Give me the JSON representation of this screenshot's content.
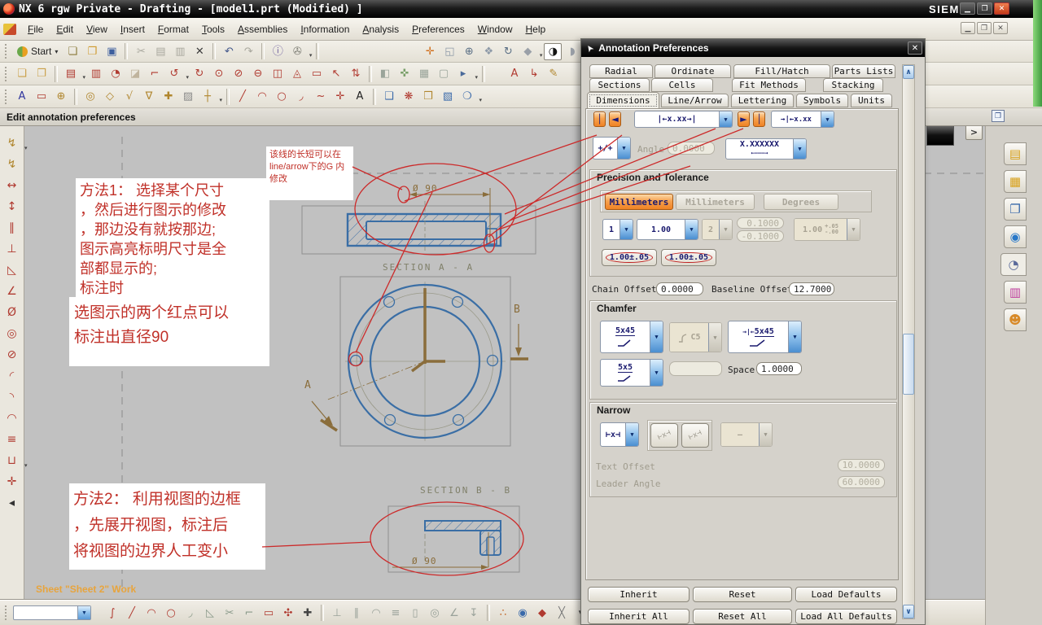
{
  "window": {
    "title": "NX 6 rgw Private - Drafting - [model1.prt (Modified) ]",
    "brand": "SIEMENS"
  },
  "menu": {
    "items": [
      "File",
      "Edit",
      "View",
      "Insert",
      "Format",
      "Tools",
      "Assemblies",
      "Information",
      "Analysis",
      "Preferences",
      "Window",
      "Help"
    ]
  },
  "prompt": "Edit annotation preferences",
  "toolbars": {
    "start_label": "Start",
    "row1": [
      {
        "n": "new-file",
        "g": "❏",
        "c": "#8a7a3a"
      },
      {
        "n": "open-file",
        "g": "❐",
        "c": "#cf9a2e"
      },
      {
        "n": "save",
        "g": "▣",
        "c": "#3d5f9e"
      },
      {
        "n": "sep"
      },
      {
        "n": "cut",
        "g": "✂",
        "c": "#a9a89e"
      },
      {
        "n": "copy",
        "g": "▤",
        "c": "#a9a89e"
      },
      {
        "n": "paste",
        "g": "▥",
        "c": "#a9a89e"
      },
      {
        "n": "delete",
        "g": "✕",
        "c": "#3b3b3b"
      },
      {
        "n": "sep"
      },
      {
        "n": "undo",
        "g": "↶",
        "c": "#44598c"
      },
      {
        "n": "redo",
        "g": "↷",
        "c": "#a9a89e"
      },
      {
        "n": "sep"
      },
      {
        "n": "information",
        "g": "ⓘ",
        "c": "#6a5a9c"
      },
      {
        "n": "command-finder",
        "g": "✇",
        "c": "#7d7d74",
        "k": "dd"
      }
    ],
    "row1_right": [
      {
        "n": "fit-view",
        "g": "✛",
        "c": "#d0701e"
      },
      {
        "n": "zoom-window",
        "g": "◱",
        "c": "#8e9aa8"
      },
      {
        "n": "zoom-in-out",
        "g": "⊕",
        "c": "#5a6f85"
      },
      {
        "n": "pan-view",
        "g": "❖",
        "c": "#8e9aa8"
      },
      {
        "n": "rotate-view",
        "g": "↻",
        "c": "#5a6f85"
      },
      {
        "n": "shaded-display",
        "g": "◆",
        "c": "#9aa0a8",
        "k": "dd"
      },
      {
        "n": "rendering-style",
        "g": "◑",
        "c": "#141414",
        "k": "box"
      },
      {
        "n": "display-options",
        "g": "◗",
        "c": "#9aa0a8",
        "k": "dd"
      },
      {
        "n": "window-display",
        "g": "■",
        "c": "#a8a8a0",
        "k": "dd"
      }
    ],
    "row2": [
      {
        "n": "new-sheet",
        "g": "❏",
        "c": "#caa04a"
      },
      {
        "n": "open-sheet",
        "g": "❐",
        "c": "#caa04a"
      },
      {
        "n": "sep"
      },
      {
        "n": "base-view",
        "g": "▤",
        "c": "#b03a30",
        "k": "dd"
      },
      {
        "n": "projected-view",
        "g": "▥",
        "c": "#b03a30"
      },
      {
        "n": "detail-view",
        "g": "◔",
        "c": "#b03a30"
      },
      {
        "n": "eraser",
        "g": "◪",
        "c": "#c0b49e"
      },
      {
        "n": "view-break",
        "g": "⌐",
        "c": "#b03a30"
      },
      {
        "n": "update-views",
        "g": "↺",
        "c": "#b03a30",
        "k": "dd"
      },
      {
        "n": "rotate-view-tool",
        "g": "↻",
        "c": "#b03a30"
      },
      {
        "n": "revolved-section-view",
        "g": "⊙",
        "c": "#b03a30"
      },
      {
        "n": "section-view",
        "g": "⊘",
        "c": "#b03a30"
      },
      {
        "n": "half-section-view",
        "g": "⊖",
        "c": "#b03a30"
      },
      {
        "n": "break-out-section",
        "g": "◫",
        "c": "#b03a30"
      },
      {
        "n": "unfolded-section-view",
        "g": "◬",
        "c": "#b03a30"
      },
      {
        "n": "view-boundary",
        "g": "▭",
        "c": "#b03a30"
      },
      {
        "n": "move-copy-view",
        "g": "↖",
        "c": "#b03a30"
      },
      {
        "n": "align-views",
        "g": "⇅",
        "c": "#b03a30"
      },
      {
        "n": "sep"
      },
      {
        "n": "sheet-layout",
        "g": "◧",
        "c": "#9aa49a"
      },
      {
        "n": "view-origin",
        "g": "✜",
        "c": "#7aa06a"
      },
      {
        "n": "drawing-format",
        "g": "▦",
        "c": "#9aa49a"
      },
      {
        "n": "display-sheet",
        "g": "▢",
        "c": "#9aa49a"
      },
      {
        "n": "selection-mode",
        "g": "▸",
        "c": "#4a6a9a",
        "k": "dd"
      }
    ],
    "row2_right": [
      {
        "n": "annotation-style",
        "g": "A",
        "c": "#b03a30"
      },
      {
        "n": "leader",
        "g": "↳",
        "c": "#b03a30"
      },
      {
        "n": "edit-object",
        "g": "✎",
        "c": "#b0862e"
      }
    ],
    "row3": [
      {
        "n": "note",
        "g": "A",
        "c": "#30369e"
      },
      {
        "n": "feature-control-frame",
        "g": "▭",
        "c": "#b03a30"
      },
      {
        "n": "datum-feature-symbol",
        "g": "⊕",
        "c": "#b0862e"
      },
      {
        "n": "sep"
      },
      {
        "n": "balloon",
        "g": "◎",
        "c": "#b0862e"
      },
      {
        "n": "id-symbol",
        "g": "◇",
        "c": "#b0862e"
      },
      {
        "n": "surface-finish-symbol",
        "g": "√",
        "c": "#b0862e"
      },
      {
        "n": "weld-symbol",
        "g": "∇",
        "c": "#b0862e"
      },
      {
        "n": "target-point-symbol",
        "g": "✚",
        "c": "#b0862e"
      },
      {
        "n": "crosshatch",
        "g": "▨",
        "c": "#8a8a8a"
      },
      {
        "n": "centerline",
        "g": "┼",
        "c": "#b0862e",
        "k": "dd"
      },
      {
        "n": "sep"
      },
      {
        "n": "line",
        "g": "╱",
        "c": "#b03a30"
      },
      {
        "n": "arc",
        "g": "◠",
        "c": "#b03a30"
      },
      {
        "n": "circle",
        "g": "○",
        "c": "#b03a30"
      },
      {
        "n": "fillet",
        "g": "◞",
        "c": "#b03a30"
      },
      {
        "n": "spline",
        "g": "~",
        "c": "#b03a30"
      },
      {
        "n": "point",
        "g": "✛",
        "c": "#b03a30"
      },
      {
        "n": "text",
        "g": "A",
        "c": "#222"
      },
      {
        "n": "sep"
      },
      {
        "n": "bounded-plane",
        "g": "❑",
        "c": "#3a6aaa"
      },
      {
        "n": "curve-edit",
        "g": "❋",
        "c": "#b03a30"
      },
      {
        "n": "pattern",
        "g": "❒",
        "c": "#b0862e"
      },
      {
        "n": "raster-image",
        "g": "▧",
        "c": "#3a6aaa"
      },
      {
        "n": "display-views",
        "g": "❍",
        "c": "#3a6aaa",
        "k": "dd"
      }
    ],
    "left": [
      {
        "n": "inferred-dimension",
        "g": "↯",
        "c": "#b0862e",
        "k": "dd"
      },
      {
        "n": "auto-dimension",
        "g": "↯",
        "c": "#b0862e"
      },
      {
        "n": "horizontal-dimension",
        "g": "↔",
        "c": "#b03a30"
      },
      {
        "n": "vertical-dimension",
        "g": "↕",
        "c": "#b03a30"
      },
      {
        "n": "parallel-dimension",
        "g": "∥",
        "c": "#b03a30"
      },
      {
        "n": "perpendicular-dimension",
        "g": "⊥",
        "c": "#b03a30"
      },
      {
        "n": "chamfer-dimension",
        "g": "◺",
        "c": "#b03a30"
      },
      {
        "n": "angular-dimension",
        "g": "∠",
        "c": "#b03a30"
      },
      {
        "n": "cylindrical-dimension",
        "g": "Ø",
        "c": "#b03a30"
      },
      {
        "n": "hole-dimension",
        "g": "◎",
        "c": "#b03a30"
      },
      {
        "n": "diameter-dimension",
        "g": "⊘",
        "c": "#b03a30"
      },
      {
        "n": "radius-dimension",
        "g": "◜",
        "c": "#b03a30"
      },
      {
        "n": "radius-to-center-dimension",
        "g": "◝",
        "c": "#b03a30"
      },
      {
        "n": "folded-radius-dimension",
        "g": "◠",
        "c": "#b03a30"
      },
      {
        "n": "thickness-dimension",
        "g": "≡",
        "c": "#b03a30"
      },
      {
        "n": "ordinate-dimension",
        "g": "⊔",
        "c": "#b03a30",
        "k": "dd"
      },
      {
        "n": "crosshair",
        "g": "✛",
        "c": "#b03a30"
      },
      {
        "n": "collapse",
        "g": "◂",
        "c": "#333"
      }
    ],
    "bottom": [
      {
        "n": "profile",
        "g": "∫",
        "c": "#b03a30"
      },
      {
        "n": "sketch-line",
        "g": "╱",
        "c": "#b03a30"
      },
      {
        "n": "sketch-arc",
        "g": "◠",
        "c": "#b03a30"
      },
      {
        "n": "sketch-circle",
        "g": "○",
        "c": "#b03a30"
      },
      {
        "n": "sketch-fillet",
        "g": "◞",
        "c": "#8a9a8a"
      },
      {
        "n": "sketch-chamfer",
        "g": "◺",
        "c": "#8a9a8a"
      },
      {
        "n": "quick-trim",
        "g": "✂",
        "c": "#8a9a8a"
      },
      {
        "n": "quick-extend",
        "g": "⌐",
        "c": "#8a9a8a"
      },
      {
        "n": "rectangle",
        "g": "▭",
        "c": "#b03a30"
      },
      {
        "n": "pattern-curve",
        "g": "✣",
        "c": "#b03a30"
      },
      {
        "n": "sketch-point",
        "g": "✚",
        "c": "#444"
      },
      {
        "n": "sep"
      },
      {
        "n": "constraint-perpendicular",
        "g": "⊥",
        "c": "#9aa29a"
      },
      {
        "n": "constraint-parallel",
        "g": "∥",
        "c": "#9aa29a"
      },
      {
        "n": "constraint-tangent",
        "g": "◠",
        "c": "#9aa29a"
      },
      {
        "n": "constraint-equal",
        "g": "≡",
        "c": "#9aa29a"
      },
      {
        "n": "constraint-collinear",
        "g": "▯",
        "c": "#9aa29a"
      },
      {
        "n": "constraint-concentric",
        "g": "◎",
        "c": "#9aa29a"
      },
      {
        "n": "constraint-angle",
        "g": "∠",
        "c": "#9aa29a"
      },
      {
        "n": "constraint-fix",
        "g": "↧",
        "c": "#9aa29a"
      },
      {
        "n": "sep"
      },
      {
        "n": "snap-point",
        "g": "∴",
        "c": "#c06020"
      },
      {
        "n": "end-point-snap",
        "g": "◉",
        "c": "#3a6aaa"
      },
      {
        "n": "mid-point-snap",
        "g": "◆",
        "c": "#b03a30"
      },
      {
        "n": "intersection-snap",
        "g": "╳",
        "c": "#777"
      },
      {
        "n": "overflow",
        "g": "▾",
        "c": "#444"
      }
    ],
    "resource": [
      {
        "n": "assembly-navigator",
        "g": "▤",
        "c": "#d8a018"
      },
      {
        "n": "constraint-navigator",
        "g": "▦",
        "c": "#d8a018"
      },
      {
        "n": "part-navigator",
        "g": "❐",
        "c": "#3a6aaa"
      },
      {
        "n": "web-browser",
        "g": "◉",
        "c": "#2878c8"
      },
      {
        "n": "history",
        "g": "◔",
        "c": "#5a6a9a",
        "k": "active"
      },
      {
        "n": "palettes",
        "g": "▥",
        "c": "#c040a0"
      },
      {
        "n": "roles",
        "g": "☻",
        "c": "#d88a28"
      }
    ]
  },
  "canvas": {
    "sheet_status": "Sheet \"Sheet 2\" Work",
    "note1": "该线的长短可以在\nline/arrow下的G 内\n修改",
    "method1": "方法1： 选择某个尺寸\n，然后进行图示的修改\n，那边没有就按那边;\n图示高亮标明尺寸是全\n部都显示的;\n标注时",
    "method1b": "选图示的两个红点可以\n标注出直径90",
    "method2": "方法2： 利用视图的边框\n，先展开视图，标注后\n将视图的边界人工变小",
    "dim_top": "Ø 90",
    "dim_bottom": "Ø 90",
    "section_a": "SECTION A - A",
    "section_b": "SECTION B - B",
    "label_a": "A",
    "label_b": "B"
  },
  "dialog": {
    "title": "Annotation Preferences",
    "tabs": {
      "row1": [
        "Radial",
        "Ordinate",
        "Fill/Hatch",
        "Parts Lists"
      ],
      "row2": [
        "Sections",
        "Cells",
        "Fit Methods",
        "Stacking"
      ],
      "row3": [
        "Dimensions",
        "Line/Arrow",
        "Lettering",
        "Symbols",
        "Units"
      ]
    },
    "top": {
      "g1": "│",
      "g2": "◄",
      "g3": "►",
      "g4": "│",
      "dd1": "|←x.xx→|",
      "dd2": "→|←x.xx",
      "dd3": "+∕+",
      "angle_label": "Angle",
      "angle_value": "0.0000",
      "dd4": "X.XXXXXX",
      "dd4_sub": "←―――→"
    },
    "precision": {
      "title": "Precision and Tolerance",
      "seg1": "Millimeters",
      "seg2": "Millimeters",
      "seg3": "Degrees",
      "dp1": "1",
      "dp2": "1.00",
      "dp3": "2",
      "tol_up": "0.1000",
      "tol_dn": "-0.1000",
      "tolfmt_main": "1.00",
      "tolfmt_up": "+.05",
      "tolfmt_dn": "-.00",
      "toggle1": "1.00±.05",
      "toggle2": "1.00±.05"
    },
    "offsets": {
      "chain_label": "Chain Offset",
      "chain_value": "0.0000",
      "baseline_label": "Baseline Offset",
      "baseline_value": "12.7000"
    },
    "chamfer": {
      "title": "Chamfer",
      "c1": "5x45",
      "c2": "C5",
      "c3_prefix": "→|←",
      "c3": "5x45",
      "c4": "5x5",
      "space_label": "Space",
      "space_value": "1.0000"
    },
    "narrow": {
      "title": "Narrow",
      "n1": "⊢x⊣",
      "pair1": "⊢x⊣",
      "pair2": "⊢x⊣",
      "n2": "—",
      "text_offset_label": "Text Offset",
      "text_offset_value": "10.0000",
      "leader_label": "Leader Angle",
      "leader_value": "60.0000"
    },
    "buttons": [
      "Inherit",
      "Reset",
      "Load Defaults",
      "Inherit All",
      "Reset All",
      "Load All Defaults"
    ]
  }
}
